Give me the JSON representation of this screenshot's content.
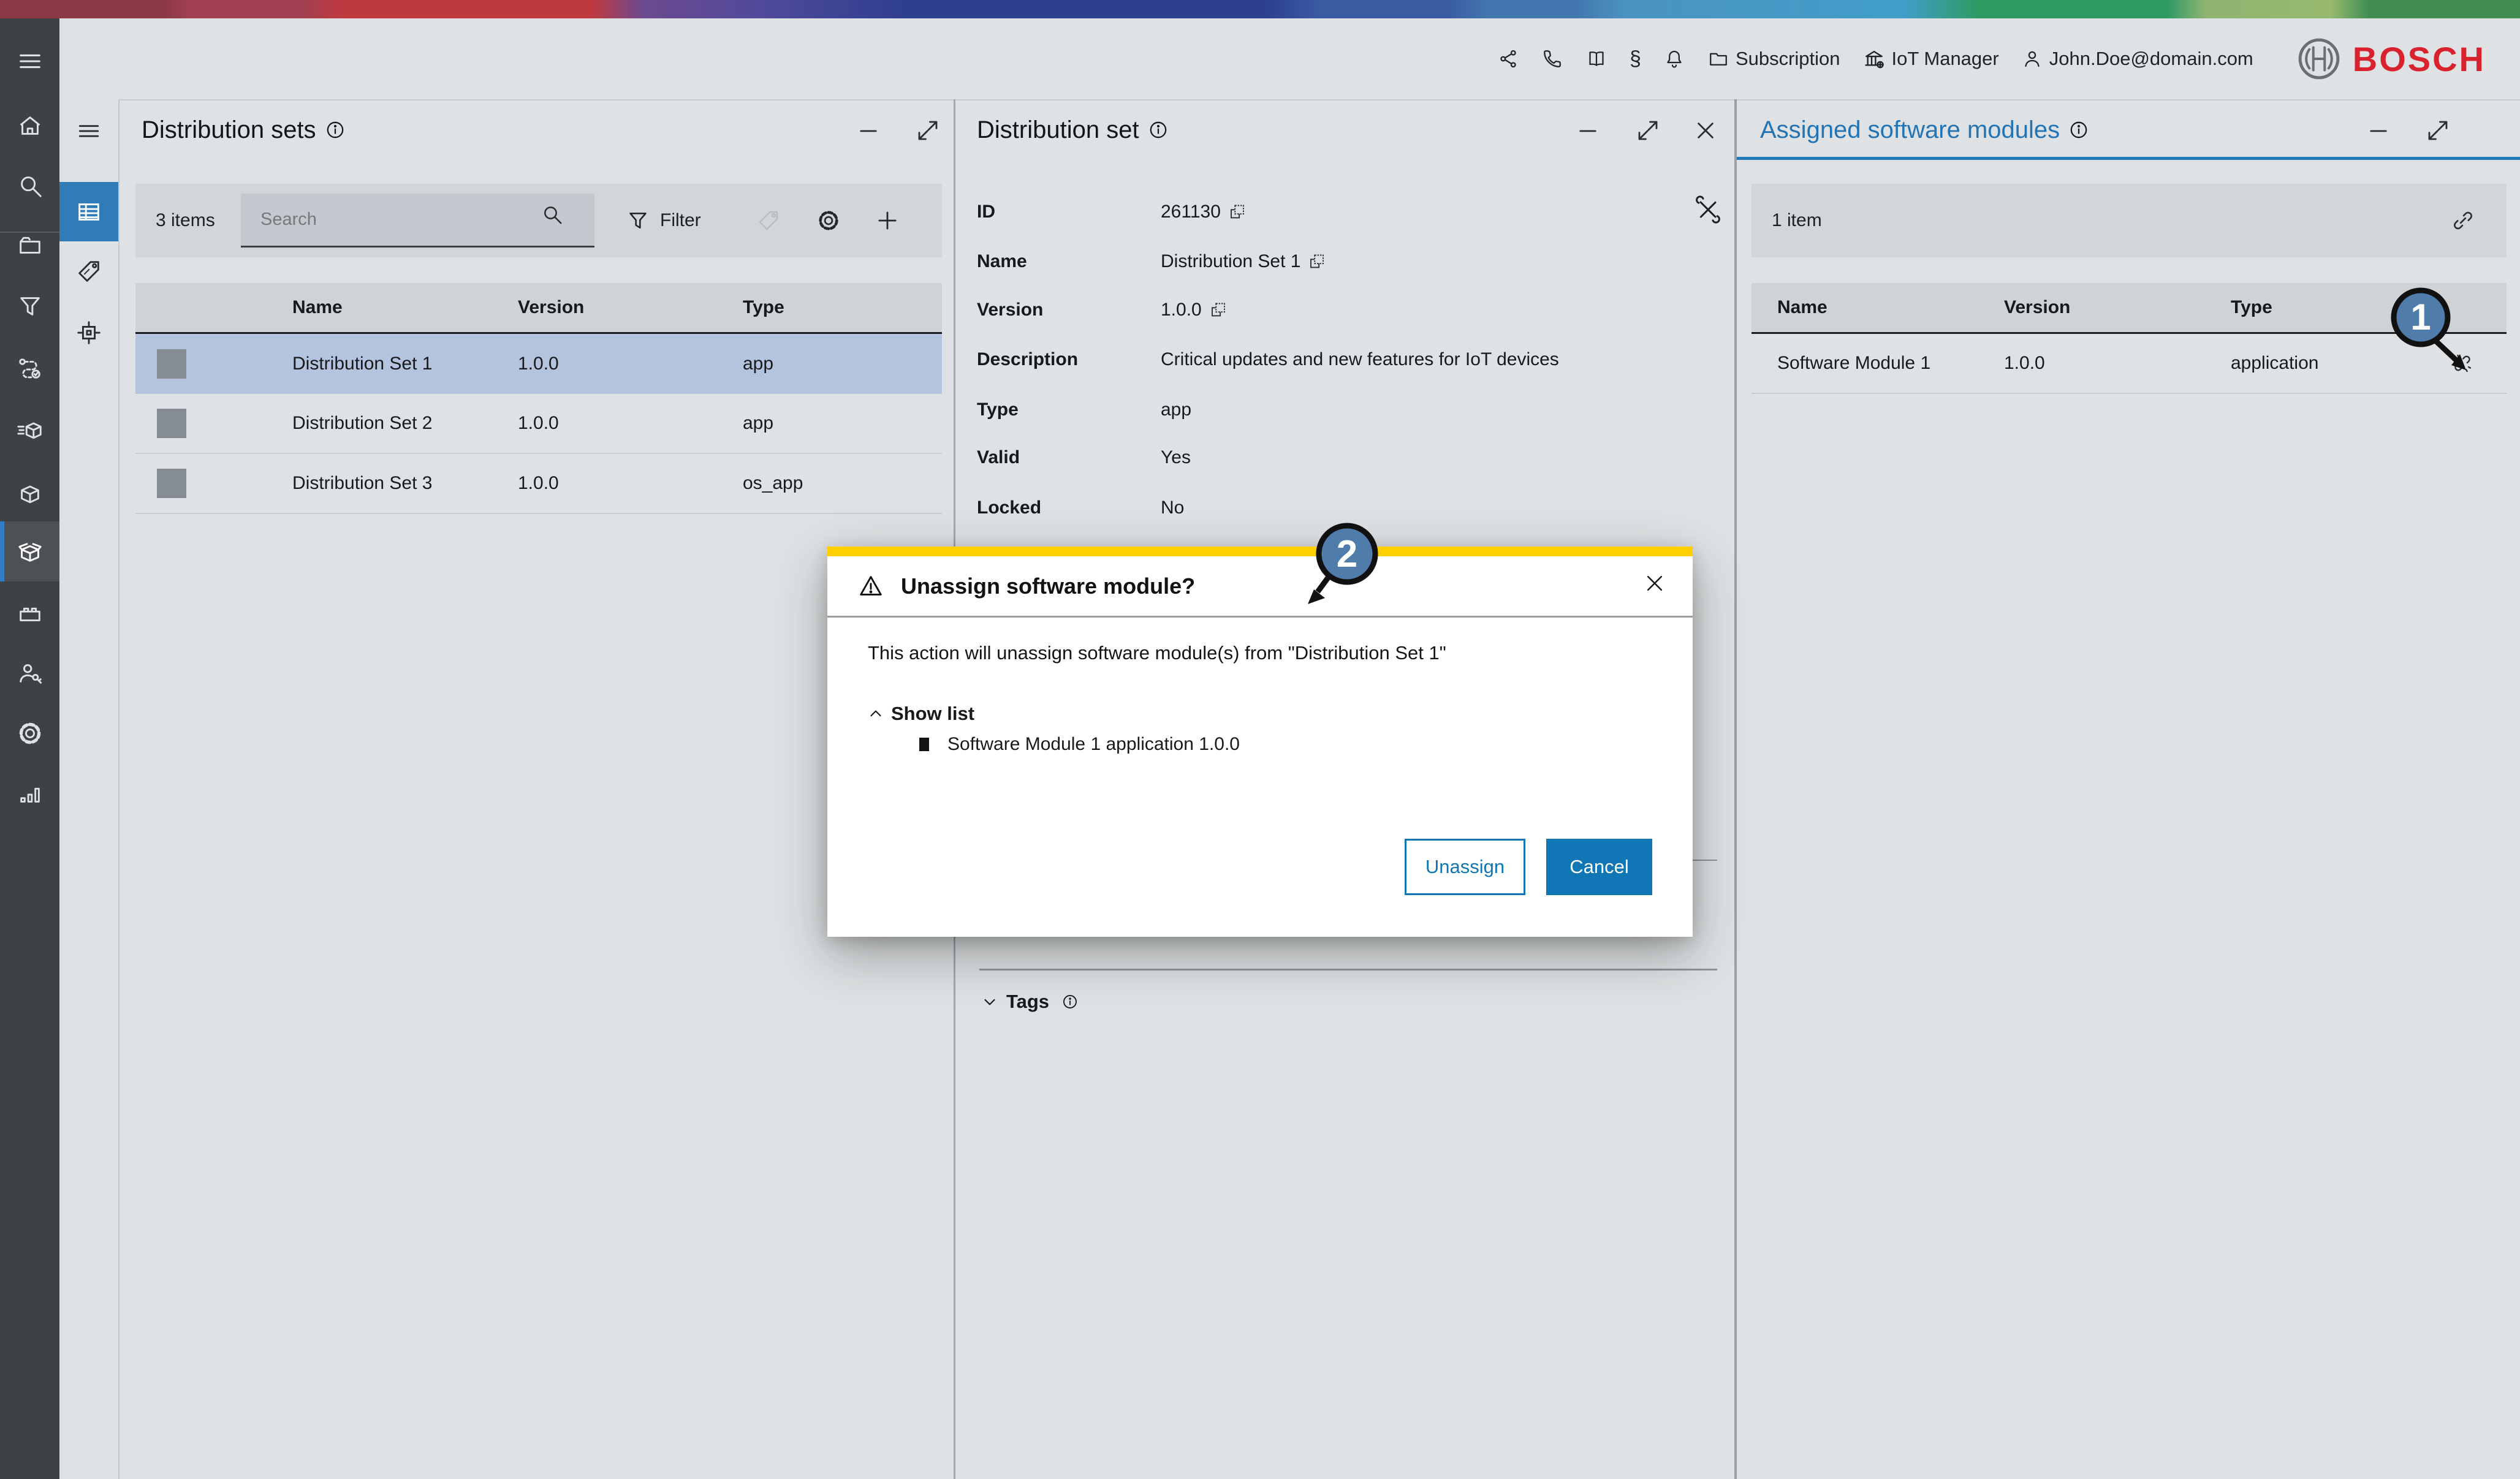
{
  "header": {
    "subscription_label": "Subscription",
    "tenant_label": "IoT Manager",
    "user_email": "John.Doe@domain.com",
    "brand": "BOSCH"
  },
  "icons": {
    "paragraph_glyph": "§"
  },
  "panel1": {
    "title": "Distribution sets",
    "items_count": "3 items",
    "search_placeholder": "Search",
    "filter_label": "Filter",
    "columns": {
      "name": "Name",
      "version": "Version",
      "type": "Type"
    },
    "rows": [
      {
        "name": "Distribution Set 1",
        "version": "1.0.0",
        "type": "app"
      },
      {
        "name": "Distribution Set 2",
        "version": "1.0.0",
        "type": "app"
      },
      {
        "name": "Distribution Set 3",
        "version": "1.0.0",
        "type": "os_app"
      }
    ]
  },
  "panel2": {
    "title": "Distribution set",
    "fields": {
      "id": {
        "label": "ID",
        "value": "261130"
      },
      "name": {
        "label": "Name",
        "value": "Distribution Set 1"
      },
      "version": {
        "label": "Version",
        "value": "1.0.0"
      },
      "description": {
        "label": "Description",
        "value": "Critical updates and new features for IoT devices"
      },
      "type": {
        "label": "Type",
        "value": "app"
      },
      "valid": {
        "label": "Valid",
        "value": "Yes"
      },
      "locked": {
        "label": "Locked",
        "value": "No"
      }
    },
    "tags_label": "Tags"
  },
  "panel3": {
    "title": "Assigned software modules",
    "items_count": "1 item",
    "columns": {
      "name": "Name",
      "version": "Version",
      "type": "Type"
    },
    "rows": [
      {
        "name": "Software Module 1",
        "version": "1.0.0",
        "type": "application"
      }
    ]
  },
  "modal": {
    "title": "Unassign software module?",
    "message": "This action will unassign software module(s) from \"Distribution Set 1\"",
    "show_list_label": "Show list",
    "list_items": [
      "Software Module 1 application 1.0.0"
    ],
    "unassign_label": "Unassign",
    "cancel_label": "Cancel"
  },
  "annotations": {
    "step1": "1",
    "step2": "2"
  },
  "colors": {
    "accent_blue": "#1176b5",
    "warning_yellow": "#ffcf00",
    "bosch_red": "#d8232f",
    "selected_row": "#b4c3de",
    "annotation_blue": "#4f7cab"
  }
}
